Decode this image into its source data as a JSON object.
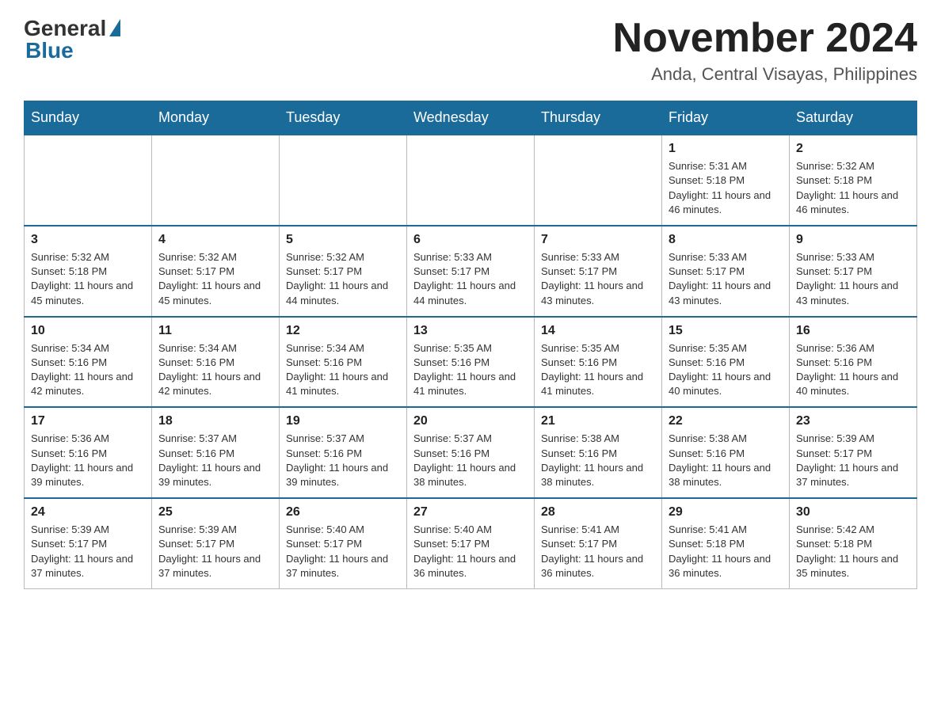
{
  "header": {
    "logo_general": "General",
    "logo_blue": "Blue",
    "month_year": "November 2024",
    "location": "Anda, Central Visayas, Philippines"
  },
  "weekdays": [
    "Sunday",
    "Monday",
    "Tuesday",
    "Wednesday",
    "Thursday",
    "Friday",
    "Saturday"
  ],
  "weeks": [
    [
      {
        "day": "",
        "info": ""
      },
      {
        "day": "",
        "info": ""
      },
      {
        "day": "",
        "info": ""
      },
      {
        "day": "",
        "info": ""
      },
      {
        "day": "",
        "info": ""
      },
      {
        "day": "1",
        "info": "Sunrise: 5:31 AM\nSunset: 5:18 PM\nDaylight: 11 hours and 46 minutes."
      },
      {
        "day": "2",
        "info": "Sunrise: 5:32 AM\nSunset: 5:18 PM\nDaylight: 11 hours and 46 minutes."
      }
    ],
    [
      {
        "day": "3",
        "info": "Sunrise: 5:32 AM\nSunset: 5:18 PM\nDaylight: 11 hours and 45 minutes."
      },
      {
        "day": "4",
        "info": "Sunrise: 5:32 AM\nSunset: 5:17 PM\nDaylight: 11 hours and 45 minutes."
      },
      {
        "day": "5",
        "info": "Sunrise: 5:32 AM\nSunset: 5:17 PM\nDaylight: 11 hours and 44 minutes."
      },
      {
        "day": "6",
        "info": "Sunrise: 5:33 AM\nSunset: 5:17 PM\nDaylight: 11 hours and 44 minutes."
      },
      {
        "day": "7",
        "info": "Sunrise: 5:33 AM\nSunset: 5:17 PM\nDaylight: 11 hours and 43 minutes."
      },
      {
        "day": "8",
        "info": "Sunrise: 5:33 AM\nSunset: 5:17 PM\nDaylight: 11 hours and 43 minutes."
      },
      {
        "day": "9",
        "info": "Sunrise: 5:33 AM\nSunset: 5:17 PM\nDaylight: 11 hours and 43 minutes."
      }
    ],
    [
      {
        "day": "10",
        "info": "Sunrise: 5:34 AM\nSunset: 5:16 PM\nDaylight: 11 hours and 42 minutes."
      },
      {
        "day": "11",
        "info": "Sunrise: 5:34 AM\nSunset: 5:16 PM\nDaylight: 11 hours and 42 minutes."
      },
      {
        "day": "12",
        "info": "Sunrise: 5:34 AM\nSunset: 5:16 PM\nDaylight: 11 hours and 41 minutes."
      },
      {
        "day": "13",
        "info": "Sunrise: 5:35 AM\nSunset: 5:16 PM\nDaylight: 11 hours and 41 minutes."
      },
      {
        "day": "14",
        "info": "Sunrise: 5:35 AM\nSunset: 5:16 PM\nDaylight: 11 hours and 41 minutes."
      },
      {
        "day": "15",
        "info": "Sunrise: 5:35 AM\nSunset: 5:16 PM\nDaylight: 11 hours and 40 minutes."
      },
      {
        "day": "16",
        "info": "Sunrise: 5:36 AM\nSunset: 5:16 PM\nDaylight: 11 hours and 40 minutes."
      }
    ],
    [
      {
        "day": "17",
        "info": "Sunrise: 5:36 AM\nSunset: 5:16 PM\nDaylight: 11 hours and 39 minutes."
      },
      {
        "day": "18",
        "info": "Sunrise: 5:37 AM\nSunset: 5:16 PM\nDaylight: 11 hours and 39 minutes."
      },
      {
        "day": "19",
        "info": "Sunrise: 5:37 AM\nSunset: 5:16 PM\nDaylight: 11 hours and 39 minutes."
      },
      {
        "day": "20",
        "info": "Sunrise: 5:37 AM\nSunset: 5:16 PM\nDaylight: 11 hours and 38 minutes."
      },
      {
        "day": "21",
        "info": "Sunrise: 5:38 AM\nSunset: 5:16 PM\nDaylight: 11 hours and 38 minutes."
      },
      {
        "day": "22",
        "info": "Sunrise: 5:38 AM\nSunset: 5:16 PM\nDaylight: 11 hours and 38 minutes."
      },
      {
        "day": "23",
        "info": "Sunrise: 5:39 AM\nSunset: 5:17 PM\nDaylight: 11 hours and 37 minutes."
      }
    ],
    [
      {
        "day": "24",
        "info": "Sunrise: 5:39 AM\nSunset: 5:17 PM\nDaylight: 11 hours and 37 minutes."
      },
      {
        "day": "25",
        "info": "Sunrise: 5:39 AM\nSunset: 5:17 PM\nDaylight: 11 hours and 37 minutes."
      },
      {
        "day": "26",
        "info": "Sunrise: 5:40 AM\nSunset: 5:17 PM\nDaylight: 11 hours and 37 minutes."
      },
      {
        "day": "27",
        "info": "Sunrise: 5:40 AM\nSunset: 5:17 PM\nDaylight: 11 hours and 36 minutes."
      },
      {
        "day": "28",
        "info": "Sunrise: 5:41 AM\nSunset: 5:17 PM\nDaylight: 11 hours and 36 minutes."
      },
      {
        "day": "29",
        "info": "Sunrise: 5:41 AM\nSunset: 5:18 PM\nDaylight: 11 hours and 36 minutes."
      },
      {
        "day": "30",
        "info": "Sunrise: 5:42 AM\nSunset: 5:18 PM\nDaylight: 11 hours and 35 minutes."
      }
    ]
  ]
}
